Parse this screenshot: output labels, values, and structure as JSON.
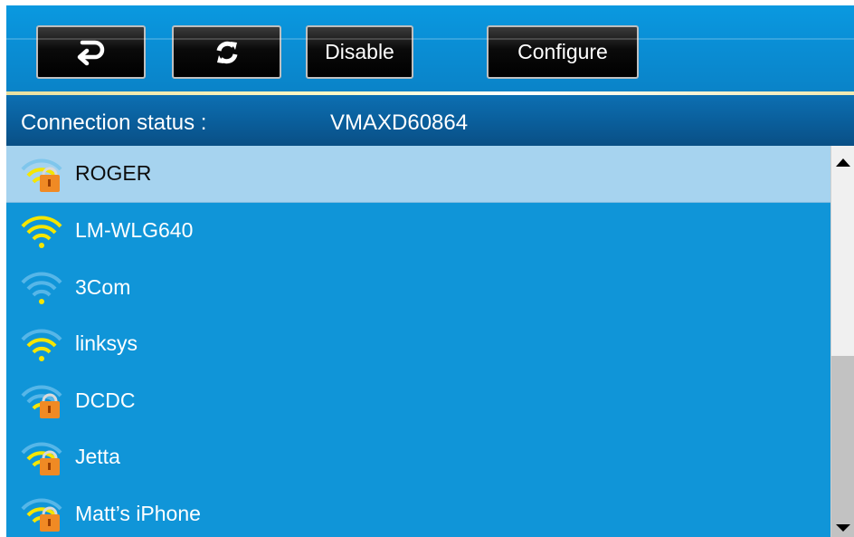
{
  "toolbar": {
    "back_icon": "back-arrow-icon",
    "refresh_icon": "refresh-icon",
    "disable_label": "Disable",
    "configure_label": "Configure"
  },
  "status": {
    "label": "Connection status :",
    "value": "VMAXD60864"
  },
  "networks": [
    {
      "ssid": "ROGER",
      "icon": "wifi-locked-icon",
      "selected": true
    },
    {
      "ssid": "LM-WLG640",
      "icon": "wifi-strong-icon",
      "selected": false
    },
    {
      "ssid": "3Com",
      "icon": "wifi-weak-icon",
      "selected": false
    },
    {
      "ssid": "linksys",
      "icon": "wifi-medium-icon",
      "selected": false
    },
    {
      "ssid": "DCDC",
      "icon": "wifi-locked-icon",
      "selected": false
    },
    {
      "ssid": "Jetta",
      "icon": "wifi-locked-icon",
      "selected": false
    },
    {
      "ssid": "Matt’s iPhone",
      "icon": "wifi-locked-icon",
      "selected": false
    }
  ],
  "colors": {
    "list_background": "#1095d8",
    "selected_row": "#a6d3ef",
    "status_bar": "#0a5c98",
    "signal_yellow": "#f5e600",
    "lock_orange": "#f08a24"
  }
}
